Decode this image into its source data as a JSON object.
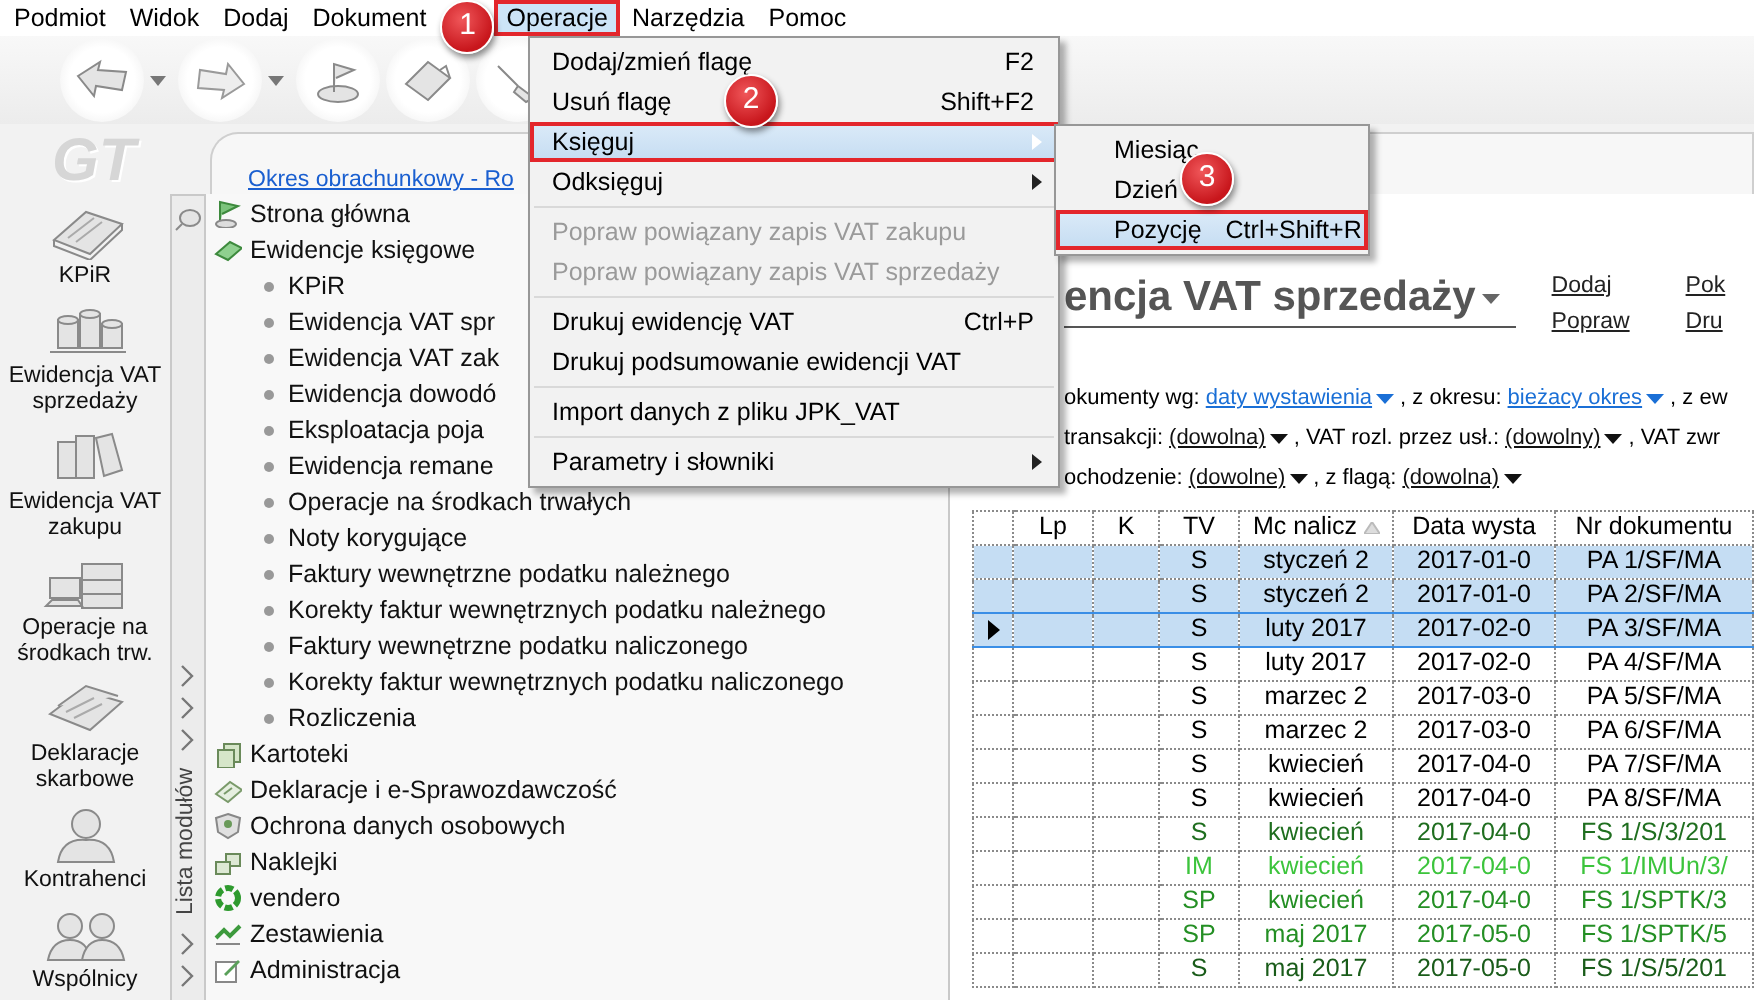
{
  "menubar": [
    {
      "label": "Podmiot",
      "selected": false,
      "framed": false
    },
    {
      "label": "Widok",
      "selected": false,
      "framed": false
    },
    {
      "label": "Dodaj",
      "selected": false,
      "framed": false
    },
    {
      "label": "Dokument",
      "selected": false,
      "framed": false
    },
    {
      "label": "Operacje",
      "selected": true,
      "framed": true
    },
    {
      "label": "Narzędzia",
      "selected": false,
      "framed": false
    },
    {
      "label": "Pomoc",
      "selected": false,
      "framed": false
    }
  ],
  "callouts": [
    "1",
    "2",
    "3"
  ],
  "logo": "GT",
  "sidebar": {
    "items": [
      {
        "label": "KPiR"
      },
      {
        "label": "Ewidencja VAT sprzedaży"
      },
      {
        "label": "Ewidencja VAT zakupu"
      },
      {
        "label": "Operacje na środkach trw."
      },
      {
        "label": "Deklaracje skarbowe"
      },
      {
        "label": "Kontrahenci"
      },
      {
        "label": "Wspólnicy"
      }
    ]
  },
  "period_link": "Okres obrachunkowy - Ro",
  "module_strip": {
    "label": "Lista modułów"
  },
  "tree": [
    {
      "label": "Strona główna"
    },
    {
      "label": "Ewidencje księgowe",
      "children": [
        {
          "label": "KPiR"
        },
        {
          "label": "Ewidencja VAT spr"
        },
        {
          "label": "Ewidencja VAT zak"
        },
        {
          "label": "Ewidencja dowodó"
        },
        {
          "label": "Eksploatacja poja"
        },
        {
          "label": "Ewidencja remane"
        },
        {
          "label": "Operacje na środkach trwałych"
        },
        {
          "label": "Noty korygujące"
        },
        {
          "label": "Faktury wewnętrzne podatku należnego"
        },
        {
          "label": "Korekty faktur wewnętrznych podatku należnego"
        },
        {
          "label": "Faktury wewnętrzne podatku naliczonego"
        },
        {
          "label": "Korekty faktur wewnętrznych podatku naliczonego"
        },
        {
          "label": "Rozliczenia"
        }
      ]
    },
    {
      "label": "Kartoteki"
    },
    {
      "label": "Deklaracje i e-Sprawozdawczość"
    },
    {
      "label": "Ochrona danych osobowych"
    },
    {
      "label": "Naklejki"
    },
    {
      "label": "vendero"
    },
    {
      "label": "Zestawienia"
    },
    {
      "label": "Administracja"
    }
  ],
  "dropdown_menu": [
    {
      "kind": "item",
      "label": "Dodaj/zmień flagę",
      "shortcut": "F2",
      "disabled": false,
      "submenu": false,
      "selected": false,
      "framed": false
    },
    {
      "kind": "item",
      "label": "Usuń flagę",
      "shortcut": "Shift+F2",
      "disabled": false,
      "submenu": false,
      "selected": false,
      "framed": false
    },
    {
      "kind": "item",
      "label": "Księguj",
      "disabled": false,
      "submenu": true,
      "selected": true,
      "framed": true
    },
    {
      "kind": "item",
      "label": "Odksięguj",
      "disabled": false,
      "submenu": true,
      "selected": false,
      "framed": false
    },
    {
      "kind": "separator"
    },
    {
      "kind": "item",
      "label": "Popraw powiązany zapis VAT zakupu",
      "disabled": true,
      "submenu": false,
      "selected": false,
      "framed": false
    },
    {
      "kind": "item",
      "label": "Popraw powiązany zapis VAT sprzedaży",
      "disabled": true,
      "submenu": false,
      "selected": false,
      "framed": false
    },
    {
      "kind": "separator"
    },
    {
      "kind": "item",
      "label": "Drukuj ewidencję VAT",
      "shortcut": "Ctrl+P",
      "disabled": false,
      "submenu": false,
      "selected": false,
      "framed": false
    },
    {
      "kind": "item",
      "label": "Drukuj podsumowanie ewidencji VAT",
      "disabled": false,
      "submenu": false,
      "selected": false,
      "framed": false
    },
    {
      "kind": "separator"
    },
    {
      "kind": "item",
      "label": "Import danych z pliku JPK_VAT",
      "disabled": false,
      "submenu": false,
      "selected": false,
      "framed": false
    },
    {
      "kind": "separator"
    },
    {
      "kind": "item",
      "label": "Parametry i słowniki",
      "disabled": false,
      "submenu": true,
      "selected": false,
      "framed": false
    }
  ],
  "submenu": [
    {
      "kind": "item",
      "label": "Miesiąc",
      "disabled": false,
      "submenu": false,
      "selected": false,
      "framed": false
    },
    {
      "kind": "item",
      "label": "Dzień",
      "disabled": false,
      "submenu": false,
      "selected": false,
      "framed": false
    },
    {
      "kind": "item",
      "label": "Pozycję",
      "shortcut": "Ctrl+Shift+R",
      "disabled": false,
      "submenu": false,
      "selected": true,
      "framed": true
    }
  ],
  "content": {
    "title": "encja VAT sprzedaży",
    "actions": [
      "Dodaj",
      "Popraw",
      "Pok",
      "Dru"
    ],
    "filters": [
      [
        {
          "kind": "label",
          "text": "okumenty wg:"
        },
        {
          "kind": "link",
          "text": "daty wystawienia"
        },
        {
          "kind": "label",
          "text": ", z okresu:"
        },
        {
          "kind": "link",
          "text": "bieżacy okres"
        },
        {
          "kind": "label",
          "text": ", z ew"
        }
      ],
      [
        {
          "kind": "label",
          "text": "transakcji:"
        },
        {
          "kind": "dropdown",
          "text": "(dowolna)"
        },
        {
          "kind": "label",
          "text": ", VAT rozl. przez usł.:"
        },
        {
          "kind": "dropdown",
          "text": "(dowolny)"
        },
        {
          "kind": "label",
          "text": ", VAT zwr"
        }
      ],
      [
        {
          "kind": "label",
          "text": "ochodzenie:"
        },
        {
          "kind": "dropdown",
          "text": "(dowolne)"
        },
        {
          "kind": "label",
          "text": ", z flagą:"
        },
        {
          "kind": "dropdown",
          "text": "(dowolna)"
        }
      ]
    ]
  },
  "table": {
    "columns": [
      {
        "label": "Lp",
        "sorted": false
      },
      {
        "label": "K",
        "sorted": false
      },
      {
        "label": "TV",
        "sorted": false
      },
      {
        "label": "Mc nalicz",
        "sorted": true
      },
      {
        "label": "Data wysta",
        "sorted": false
      },
      {
        "label": "Nr dokumentu",
        "sorted": false
      }
    ],
    "rows": [
      {
        "tv": "S",
        "month": "styczeń 2",
        "date": "2017-01-0",
        "number": "PA 1/SF/MA",
        "selected": true,
        "current": false,
        "color": "#000000"
      },
      {
        "tv": "S",
        "month": "styczeń 2",
        "date": "2017-01-0",
        "number": "PA 2/SF/MA",
        "selected": true,
        "current": false,
        "color": "#000000"
      },
      {
        "tv": "S",
        "month": "luty 2017",
        "date": "2017-02-0",
        "number": "PA 3/SF/MA",
        "selected": true,
        "current": true,
        "color": "#000000"
      },
      {
        "tv": "S",
        "month": "luty 2017",
        "date": "2017-02-0",
        "number": "PA 4/SF/MA",
        "selected": false,
        "current": false,
        "color": "#000000"
      },
      {
        "tv": "S",
        "month": "marzec 2",
        "date": "2017-03-0",
        "number": "PA 5/SF/MA",
        "selected": false,
        "current": false,
        "color": "#000000"
      },
      {
        "tv": "S",
        "month": "marzec 2",
        "date": "2017-03-0",
        "number": "PA 6/SF/MA",
        "selected": false,
        "current": false,
        "color": "#000000"
      },
      {
        "tv": "S",
        "month": "kwiecień",
        "date": "2017-04-0",
        "number": "PA 7/SF/MA",
        "selected": false,
        "current": false,
        "color": "#000000"
      },
      {
        "tv": "S",
        "month": "kwiecień",
        "date": "2017-04-0",
        "number": "PA 8/SF/MA",
        "selected": false,
        "current": false,
        "color": "#000000"
      },
      {
        "tv": "S",
        "month": "kwiecień",
        "date": "2017-04-0",
        "number": "FS 1/S/3/201",
        "selected": false,
        "current": false,
        "color": "#1f6e1f"
      },
      {
        "tv": "IM",
        "month": "kwiecień",
        "date": "2017-04-0",
        "number": "FS 1/IMUn/3/",
        "selected": false,
        "current": false,
        "color": "#3cc43c"
      },
      {
        "tv": "SP",
        "month": "kwiecień",
        "date": "2017-04-0",
        "number": "FS 1/SPTK/3",
        "selected": false,
        "current": false,
        "color": "#248f24"
      },
      {
        "tv": "SP",
        "month": "maj 2017",
        "date": "2017-05-0",
        "number": "FS 1/SPTK/5",
        "selected": false,
        "current": false,
        "color": "#248f24"
      },
      {
        "tv": "S",
        "month": "maj 2017",
        "date": "2017-05-0",
        "number": "FS 1/S/5/201",
        "selected": false,
        "current": false,
        "color": "#1a5c1a"
      }
    ]
  }
}
